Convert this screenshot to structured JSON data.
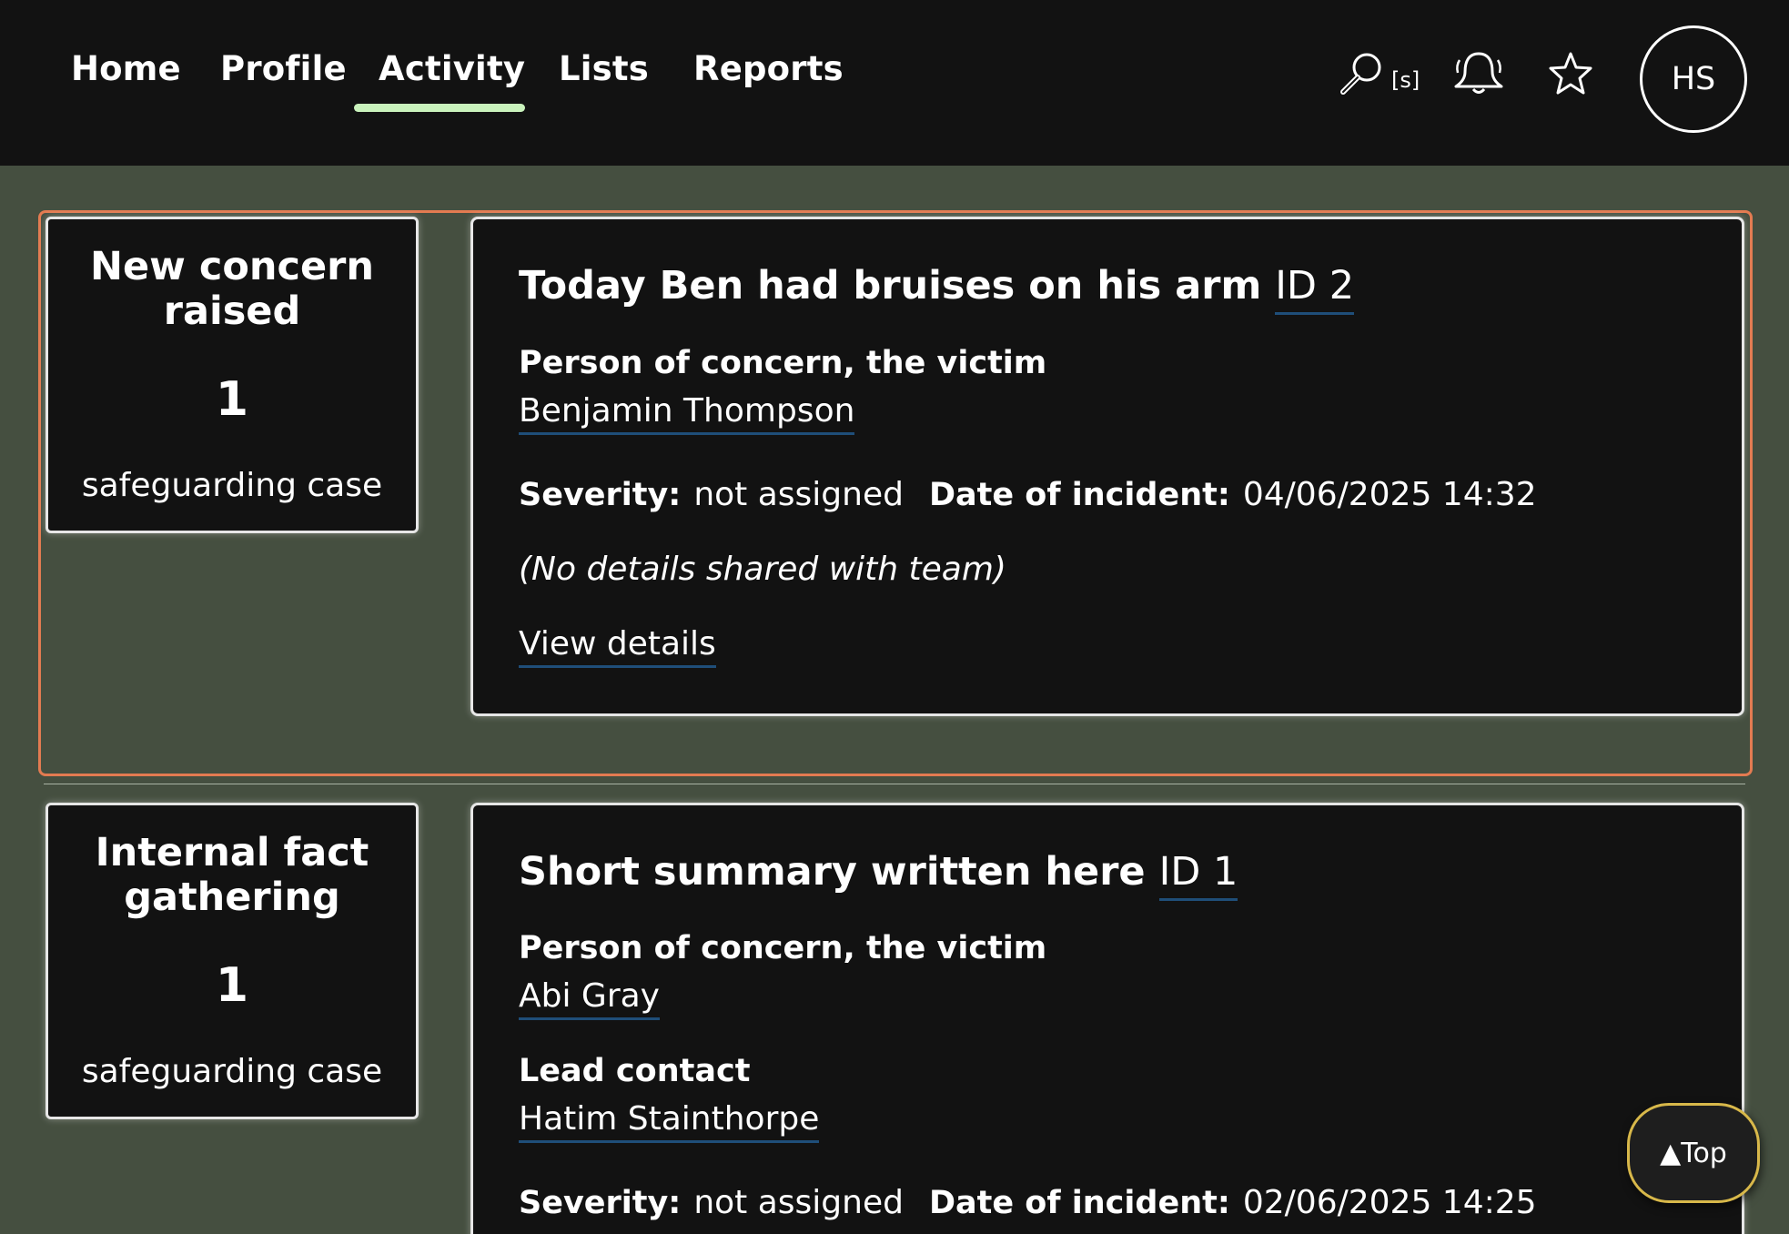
{
  "nav": {
    "items": [
      {
        "label": "Home"
      },
      {
        "label": "Profile"
      },
      {
        "label": "Activity"
      },
      {
        "label": "Lists"
      },
      {
        "label": "Reports"
      }
    ],
    "active": "Activity",
    "search_shortcut": "[s]",
    "avatar_initials": "HS",
    "icons": [
      "search-icon",
      "bell-icon",
      "star-icon"
    ]
  },
  "activity": [
    {
      "stage": {
        "title": "New concern raised",
        "count": "1",
        "caption": "safeguarding case"
      },
      "case": {
        "summary": "Today Ben had bruises on his arm",
        "id_label": "ID 2",
        "person_label": "Person of concern, the victim",
        "person_name": "Benjamin Thompson",
        "severity_label": "Severity:",
        "severity_value": "not assigned",
        "date_label": "Date of incident:",
        "date_value": "04/06/2025 14:32",
        "note": "(No details shared with team)",
        "view_link": "View details"
      }
    },
    {
      "stage": {
        "title": "Internal fact gathering",
        "count": "1",
        "caption": "safeguarding case"
      },
      "case": {
        "summary": "Short summary written here",
        "id_label": "ID 1",
        "person_label": "Person of concern, the victim",
        "person_name": "Abi Gray",
        "lead_label": "Lead contact",
        "lead_name": "Hatim Stainthorpe",
        "severity_label": "Severity:",
        "severity_value": "not assigned",
        "date_label": "Date of incident:",
        "date_value": "02/06/2025 14:25"
      }
    }
  ],
  "top_button": {
    "label": "▲Top"
  },
  "colors": {
    "header_bg": "#121212",
    "page_bg": "#454f40",
    "active_tab_underline": "#c9f2bc",
    "highlight_border": "#e37b51",
    "link_underline": "#1f4e79",
    "top_button_border": "#d8b84a"
  }
}
